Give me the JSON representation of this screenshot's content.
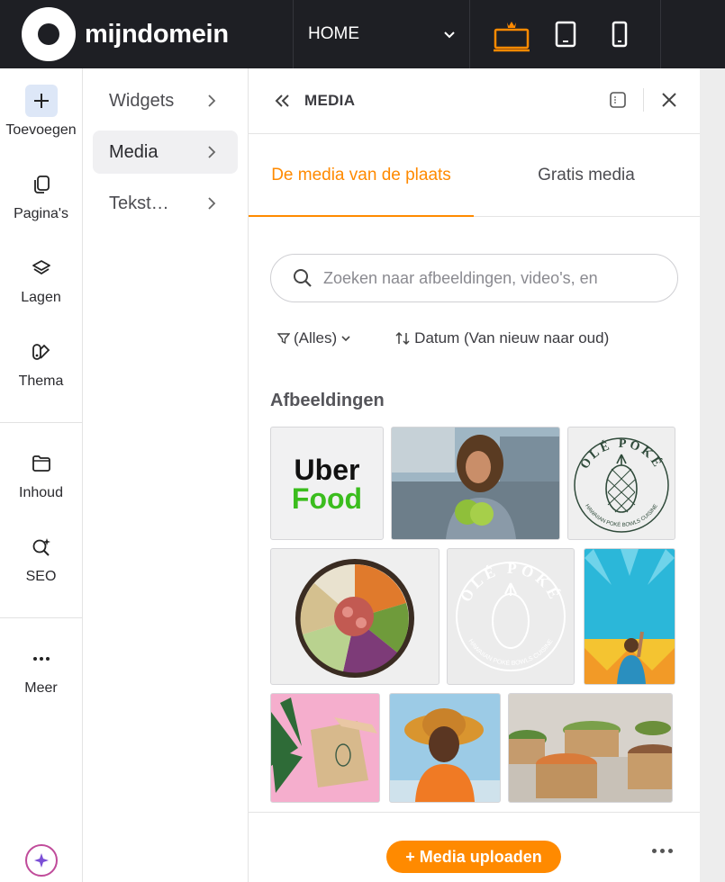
{
  "topbar": {
    "logo_text": "mijndomein",
    "page_select": "HOME",
    "devices": [
      "desktop-icon",
      "tablet-icon",
      "mobile-icon"
    ],
    "active_device": "desktop",
    "accent": "#ff8a00"
  },
  "rail": {
    "items": [
      {
        "label": "Toevoegen",
        "icon": "plus-icon"
      },
      {
        "label": "Pagina's",
        "icon": "pages-icon"
      },
      {
        "label": "Lagen",
        "icon": "layers-icon"
      },
      {
        "label": "Thema",
        "icon": "theme-icon"
      },
      {
        "label": "Inhoud",
        "icon": "folder-icon"
      },
      {
        "label": "SEO",
        "icon": "seo-icon"
      },
      {
        "label": "Meer",
        "icon": "more-icon"
      }
    ]
  },
  "categories": [
    {
      "label": "Widgets"
    },
    {
      "label": "Media",
      "active": true
    },
    {
      "label": "Tekst…"
    }
  ],
  "panel": {
    "title": "MEDIA",
    "tabs": [
      {
        "label": "De media van de plaats",
        "active": true
      },
      {
        "label": "Gratis media"
      }
    ],
    "search": {
      "placeholder": "Zoeken naar afbeeldingen, video's, en",
      "value": ""
    },
    "filter_label": "(Alles)",
    "sort_label": "Datum (Van nieuw naar oud)",
    "section_title": "Afbeeldingen",
    "images": [
      {
        "name": "uber-food-logo",
        "text_line1": "Uber",
        "text_line2": "Food"
      },
      {
        "name": "man-with-coconut-photo"
      },
      {
        "name": "ole-poke-logo",
        "text": "OLÉ POKÉ",
        "subtext": "HAWAIIAN POKÉ BOWLS CUISINE"
      },
      {
        "name": "poke-bowl-photo"
      },
      {
        "name": "ole-poke-logo-white",
        "text": "OLÉ POKÉ",
        "subtext": "HAWAIIAN POKÉ BOWLS CUISINE"
      },
      {
        "name": "woman-pineapple-wall-photo"
      },
      {
        "name": "takeaway-bag-photo"
      },
      {
        "name": "woman-orange-hat-photo"
      },
      {
        "name": "poke-bowls-table-photo"
      }
    ],
    "upload_label": "+ Media uploaden"
  }
}
